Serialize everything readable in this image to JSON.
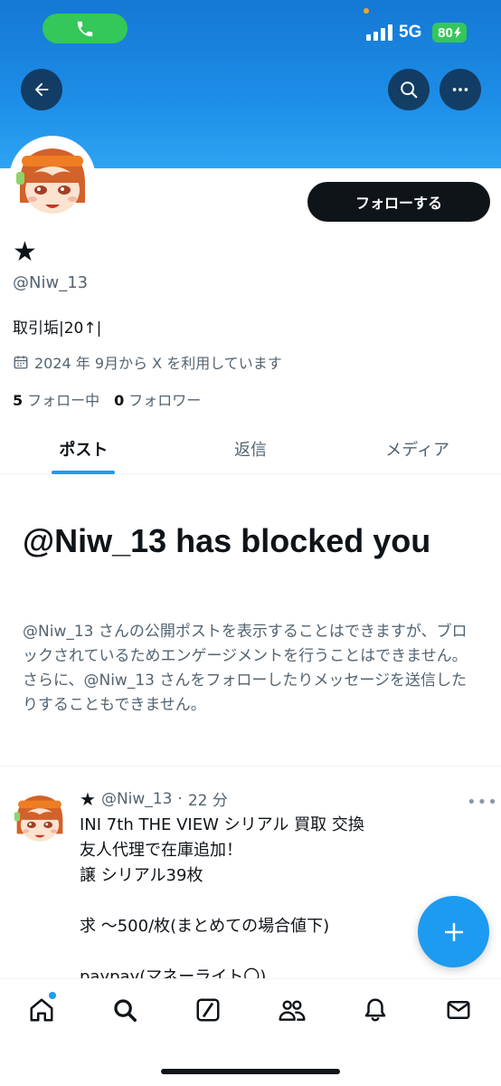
{
  "profile": {
    "display_name": "★",
    "handle": "@Niw_13",
    "bio": "取引垢|20↑|",
    "joined": "2024 年 9月から X を利用しています",
    "following_count": "5",
    "following_label": "フォロー中",
    "followers_count": "0",
    "followers_label": "フォロワー",
    "follow_button": "フォローする"
  },
  "status_bar": {
    "network": "5G",
    "battery": "80"
  },
  "tabs": [
    {
      "label": "ポスト",
      "active": true
    },
    {
      "label": "返信",
      "active": false
    },
    {
      "label": "メディア",
      "active": false
    }
  ],
  "blocked": {
    "title": "@Niw_13 has blocked you",
    "description": "@Niw_13 さんの公開ポストを表示することはできますが、ブロックされているためエンゲージメントを行うことはできません。さらに、@Niw_13 さんをフォローしたりメッセージを送信したりすることもできません。"
  },
  "post": {
    "author_name": "★",
    "handle": "@Niw_13",
    "separator": "·",
    "time": "22 分",
    "more": "•••",
    "text": "INI 7th THE VIEW シリアル 買取 交換\n友人代理で在庫追加！\n譲 シリアル39枚\n\n求 〜500/枚(まとめての場合値下)\n\npaypay(マネーライト〇)"
  },
  "icons": {
    "back": "arrow-left-icon",
    "search": "search-icon",
    "more": "more-horizontal-icon",
    "calendar": "calendar-icon",
    "compose": "plus-icon",
    "nav": [
      "home-icon",
      "search-icon",
      "grok-icon",
      "communities-icon",
      "notifications-icon",
      "messages-icon"
    ]
  },
  "colors": {
    "accent": "#1d9bf0",
    "banner": "#1d8ee8",
    "text_primary": "#0f1419",
    "text_secondary": "#536471"
  }
}
